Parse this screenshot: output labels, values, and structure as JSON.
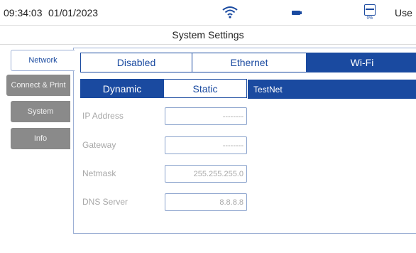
{
  "status": {
    "time": "09:34:03",
    "date": "01/01/2023",
    "user": "Use",
    "storage_percent": "0%",
    "icons": [
      "wifi-icon",
      "battery-icon",
      "storage-icon"
    ]
  },
  "title": "System Settings",
  "sidebar": {
    "items": [
      {
        "label": "Network",
        "active": true
      },
      {
        "label": "Connect & Print",
        "active": false
      },
      {
        "label": "System",
        "active": false
      },
      {
        "label": "Info",
        "active": false
      }
    ]
  },
  "connection_modes": {
    "selected": "Wi-Fi",
    "options": [
      "Disabled",
      "Ethernet",
      "Wi-Fi"
    ]
  },
  "ip_modes": {
    "selected": "Static",
    "options": [
      "Dynamic",
      "Static"
    ]
  },
  "ssid": "TestNet",
  "fields": [
    {
      "label": "IP Address",
      "value": "--------"
    },
    {
      "label": "Gateway",
      "value": "--------"
    },
    {
      "label": "Netmask",
      "value": "255.255.255.0"
    },
    {
      "label": "DNS Server",
      "value": "8.8.8.8"
    }
  ],
  "colors": {
    "accent": "#1a4aa0",
    "inactive_tab": "#8a8a8a"
  }
}
